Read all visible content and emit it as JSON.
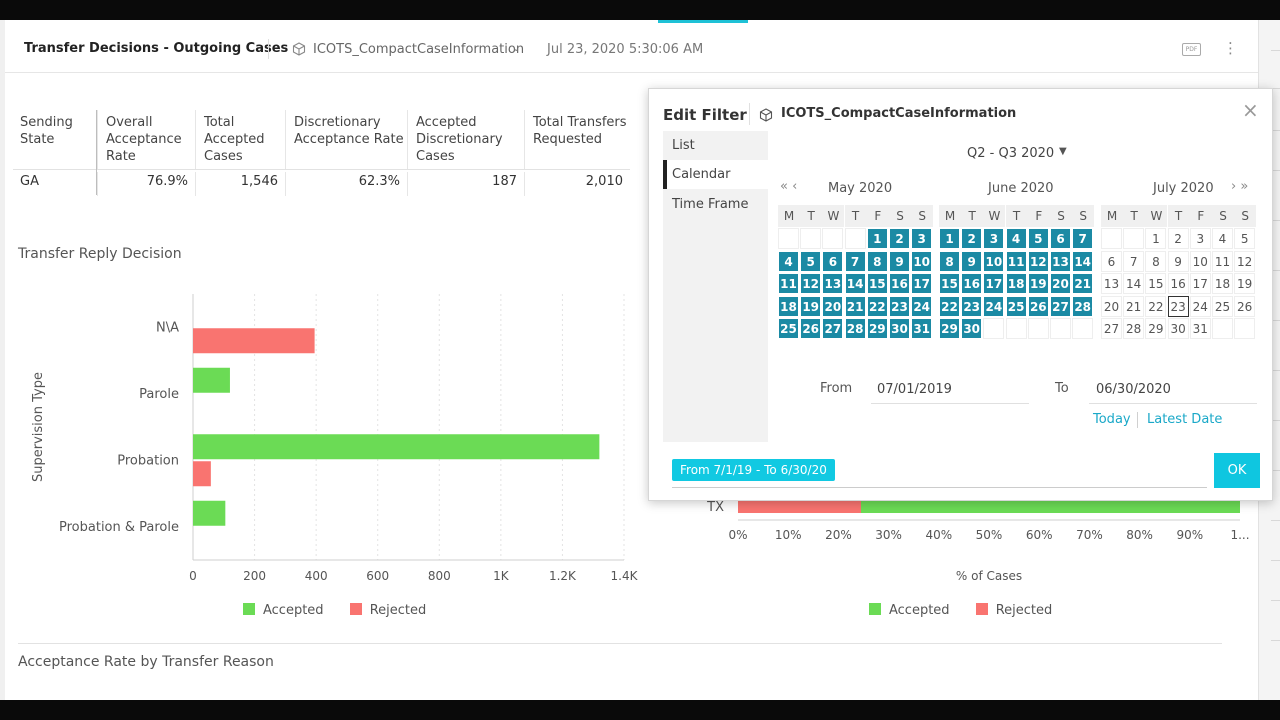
{
  "header": {
    "title": "Transfer Decisions - Outgoing Cases",
    "datasource": "ICOTS_CompactCaseInformation",
    "timestamp": "Jul 23, 2020 5:30:06 AM",
    "pdf_label": "PDF"
  },
  "table": {
    "headers": [
      "Sending State",
      "Overall Acceptance Rate",
      "Total Accepted Cases",
      "Discretionary Acceptance Rate",
      "Accepted Discretionary Cases",
      "Total Transfers Requested"
    ],
    "rows": [
      [
        "GA",
        "76.9%",
        "1,546",
        "62.3%",
        "187",
        "2,010"
      ]
    ]
  },
  "sections": {
    "reply_decision": "Transfer Reply Decision",
    "acceptance_reason": "Acceptance Rate by Transfer Reason"
  },
  "colors": {
    "accepted": "#6bdb55",
    "rejected": "#f97470",
    "calendar_selected": "#1b8aa4",
    "accent": "#0fc6e0"
  },
  "chart_data": [
    {
      "type": "bar",
      "orientation": "horizontal",
      "title": "Transfer Reply Decision",
      "ylabel": "Supervision Type",
      "xlabel": "",
      "categories": [
        "N\\A",
        "Parole",
        "Probation",
        "Probation & Parole"
      ],
      "series": [
        {
          "name": "Accepted",
          "values": [
            0,
            120,
            1320,
            105
          ]
        },
        {
          "name": "Rejected",
          "values": [
            395,
            0,
            58,
            0
          ]
        }
      ],
      "xlim": [
        0,
        1400
      ],
      "xticks": [
        "0",
        "200",
        "400",
        "600",
        "800",
        "1K",
        "1.2K",
        "1.4K"
      ],
      "legend": "bottom-center",
      "grid": true
    },
    {
      "type": "bar",
      "orientation": "horizontal",
      "stacked": true,
      "xlabel": "% of Cases",
      "categories": [
        "TX"
      ],
      "series": [
        {
          "name": "Rejected",
          "values": [
            24.5
          ]
        },
        {
          "name": "Accepted",
          "values": [
            75.5
          ]
        }
      ],
      "xlim": [
        0,
        100
      ],
      "xticks": [
        "0%",
        "10%",
        "20%",
        "30%",
        "40%",
        "50%",
        "60%",
        "70%",
        "80%",
        "90%",
        "1..."
      ],
      "legend": "bottom-center"
    }
  ],
  "legend": {
    "accepted": "Accepted",
    "rejected": "Rejected"
  },
  "filter": {
    "title": "Edit Filter",
    "datasource": "ICOTS_CompactCaseInformation",
    "close_glyph": "×",
    "tabs": [
      "List",
      "Calendar",
      "Time Frame"
    ],
    "active_tab": "Calendar",
    "range_label": "Q2 - Q3 2020",
    "nav_prev": "«  ‹",
    "nav_next": "›  »",
    "weekdays": [
      "M",
      "T",
      "W",
      "T",
      "F",
      "S",
      "S"
    ],
    "months": [
      {
        "name": "May 2020",
        "start_offset": 4,
        "days": 31,
        "selected_from": 1,
        "selected_to": 31,
        "today": null
      },
      {
        "name": "June 2020",
        "start_offset": 0,
        "days": 30,
        "selected_from": 1,
        "selected_to": 30,
        "today": null
      },
      {
        "name": "July 2020",
        "start_offset": 2,
        "days": 31,
        "selected_from": null,
        "selected_to": null,
        "today": 23
      }
    ],
    "from_label": "From",
    "from_value": "07/01/2019",
    "to_label": "To",
    "to_value": "06/30/2020",
    "today_link": "Today",
    "latest_link": "Latest Date",
    "chip": "From 7/1/19 - To 6/30/20",
    "ok": "OK"
  }
}
